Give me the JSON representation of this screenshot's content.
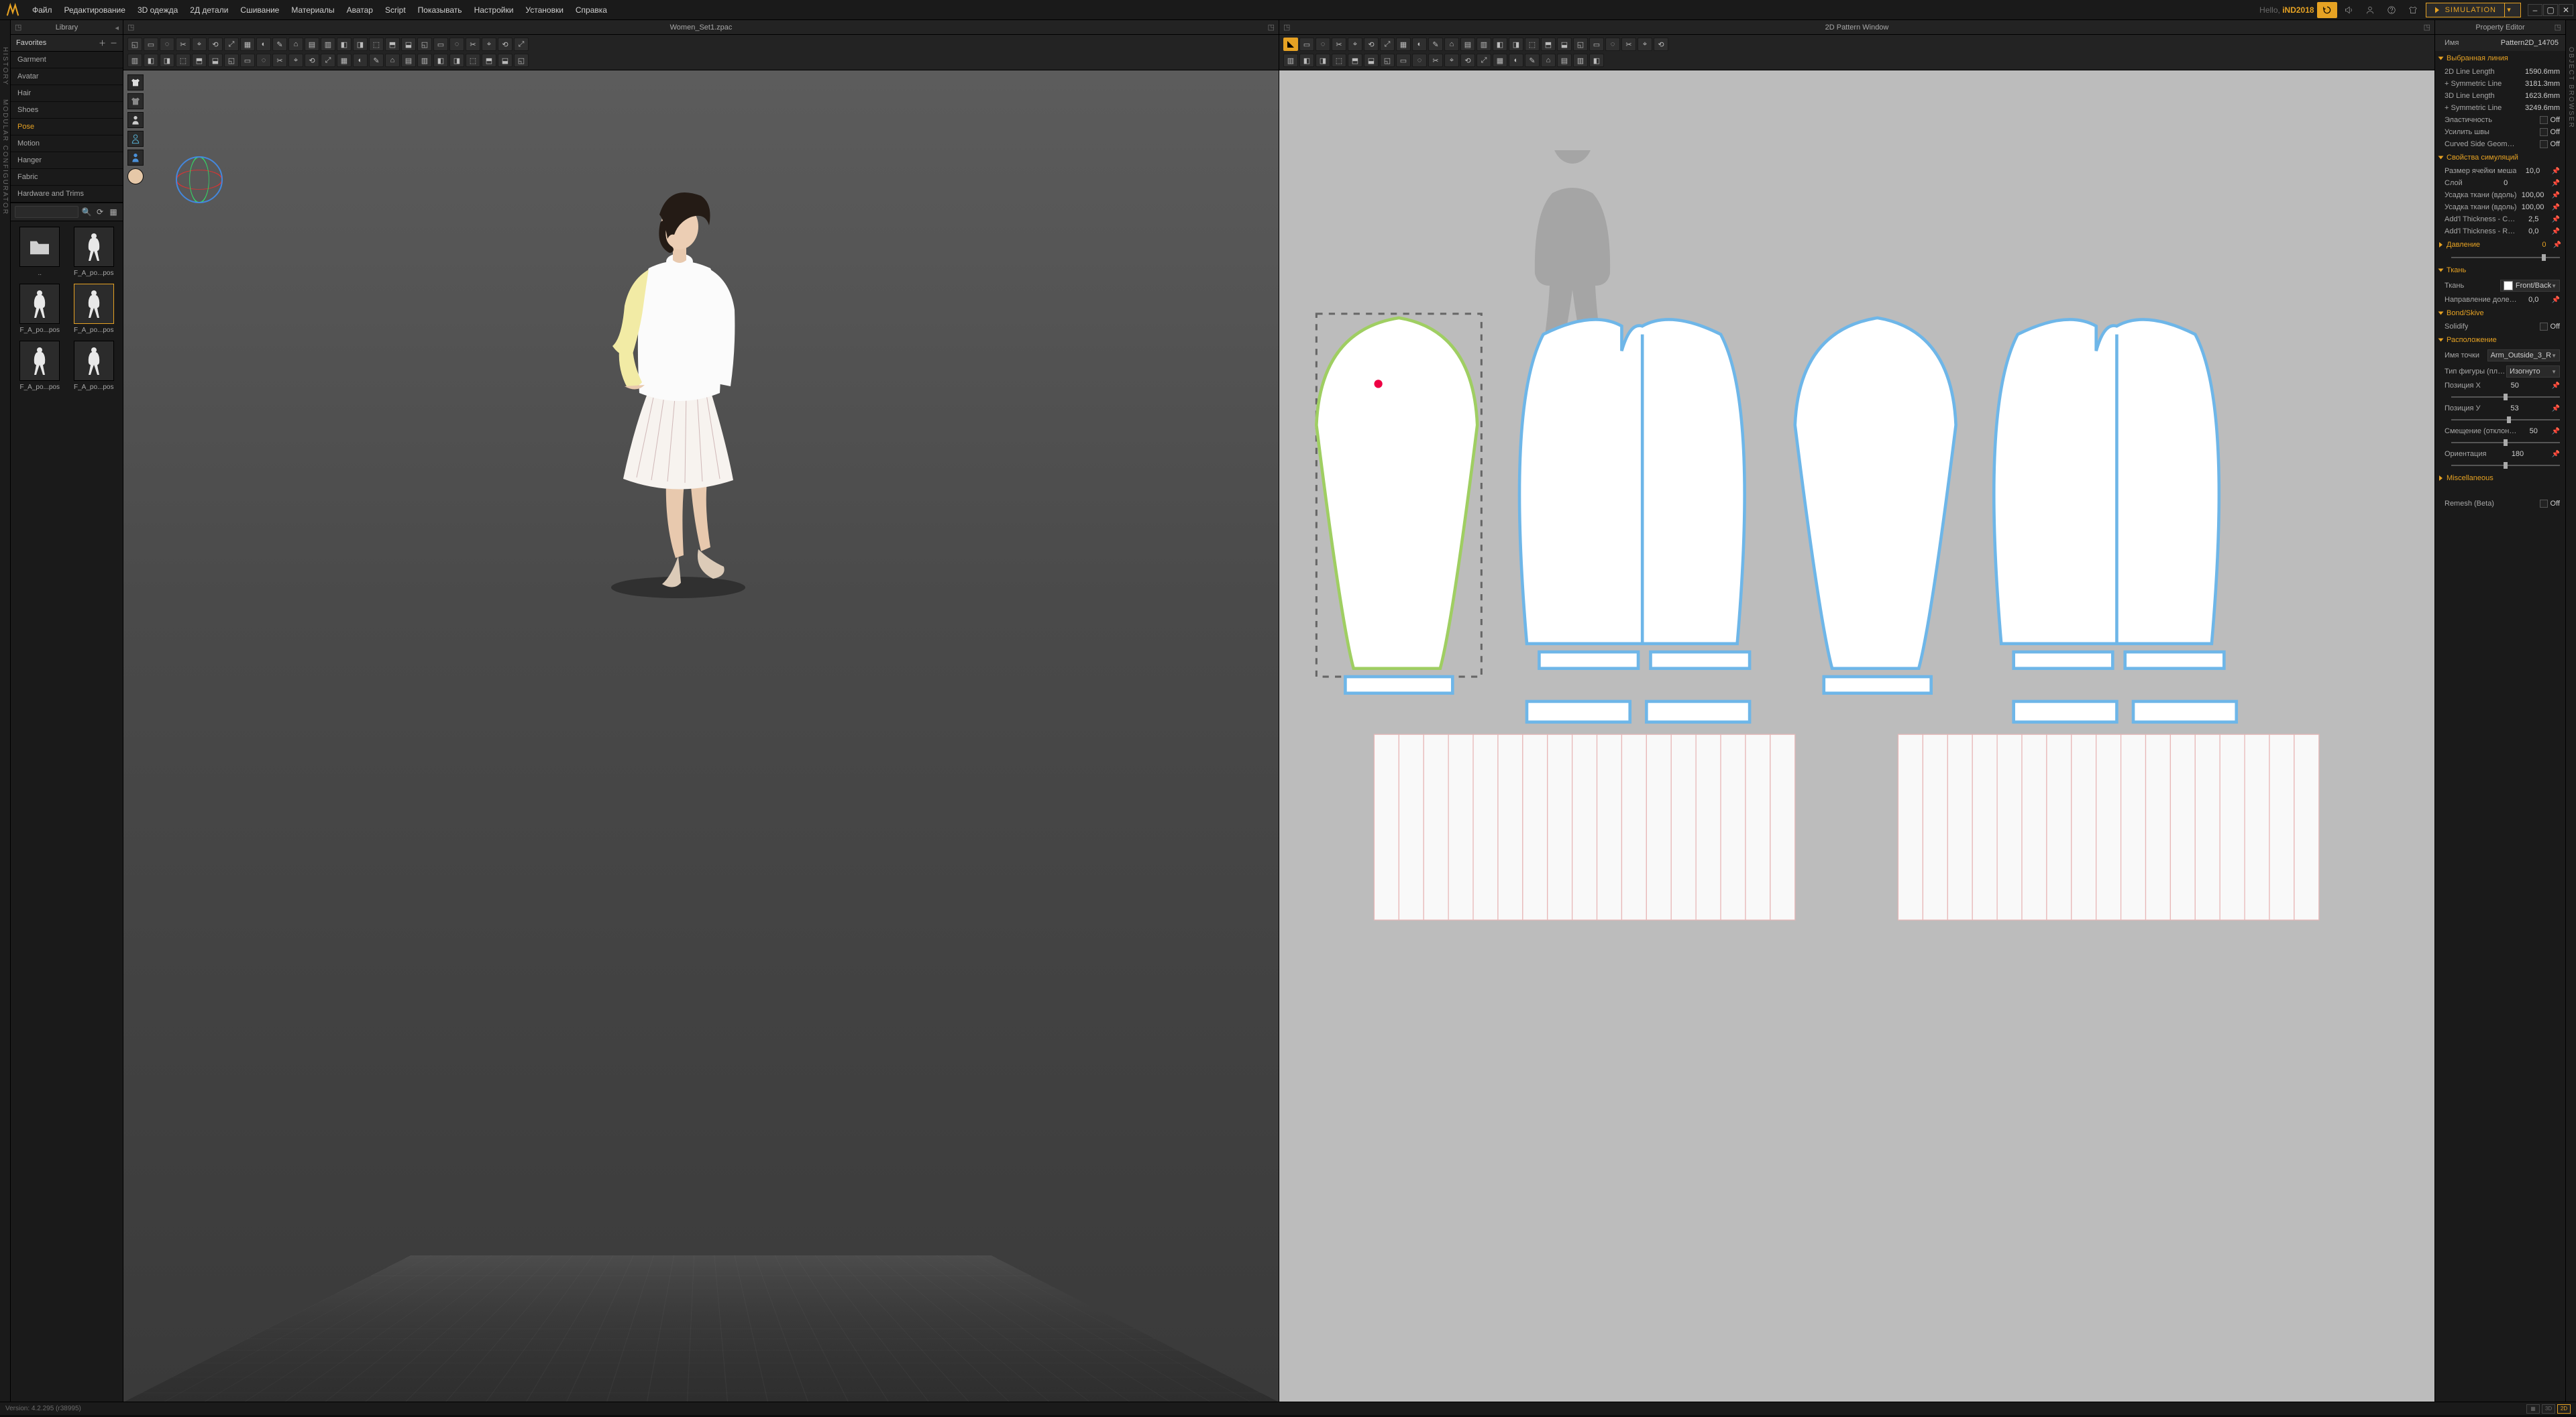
{
  "menubar": [
    "Файл",
    "Редактирование",
    "3D одежда",
    "2Д детали",
    "Сшивание",
    "Материалы",
    "Аватар",
    "Script",
    "Показывать",
    "Настройки",
    "Установки",
    "Справка"
  ],
  "hello_prefix": "Hello,",
  "username": "iND2018",
  "sim_button": "SIMULATION",
  "left_rail": [
    "HISTORY",
    "MODULAR CONFIGURATOR"
  ],
  "right_rail": [
    "OBJECT BROWSER"
  ],
  "library": {
    "title": "Library",
    "favorites_label": "Favorites",
    "categories": [
      "Garment",
      "Avatar",
      "Hair",
      "Shoes",
      "Pose",
      "Motion",
      "Hanger",
      "Fabric",
      "Hardware and Trims"
    ],
    "selected_category": "Pose",
    "thumbs": [
      {
        "label": "..",
        "type": "folder"
      },
      {
        "label": "F_A_po...pos",
        "type": "avatar"
      },
      {
        "label": "F_A_po...pos",
        "type": "avatar"
      },
      {
        "label": "F_A_po...pos",
        "type": "avatar",
        "selected": true
      },
      {
        "label": "F_A_po...pos",
        "type": "avatar"
      },
      {
        "label": "F_A_po...pos",
        "type": "avatar"
      }
    ]
  },
  "view3d": {
    "title": "Women_Set1.zpac",
    "tool_count_row1": 25,
    "tool_count_row2": 25
  },
  "view2d": {
    "title": "2D Pattern Window",
    "tool_count_row1": 24,
    "tool_count_row2": 20
  },
  "property_editor": {
    "title": "Property Editor",
    "name_label": "Имя",
    "name_value": "Pattern2D_14705",
    "sections": {
      "selected_line": {
        "title": "Выбранная линия",
        "rows": [
          {
            "k": "2D Line Length",
            "v": "1590.6mm"
          },
          {
            "k": "+ Symmetric Line",
            "v": "3181.3mm"
          },
          {
            "k": "3D Line Length",
            "v": "1623.6mm"
          },
          {
            "k": "+ Symmetric Line",
            "v": "3249.6mm"
          },
          {
            "k": "Эластичность",
            "v": "Off",
            "check": true
          },
          {
            "k": "Усилить швы",
            "v": "Off",
            "check": true
          },
          {
            "k": "Curved Side Geometry",
            "v": "Off",
            "check": true
          }
        ]
      },
      "simulation": {
        "title": "Свойства симуляций",
        "rows": [
          {
            "k": "Размер ячейки меша",
            "v": "10,0",
            "pin": true
          },
          {
            "k": "Слой",
            "v": "0",
            "pin": true
          },
          {
            "k": "Усадка ткани (вдоль)",
            "v": "100,00",
            "pin": true
          },
          {
            "k": "Усадка ткани (вдоль)",
            "v": "100,00",
            "pin": true
          },
          {
            "k": "Add'l Thickness - Collision",
            "v": "2,5",
            "pin": true
          },
          {
            "k": "Add'l Thickness - Render",
            "v": "0,0",
            "pin": true
          }
        ]
      },
      "pressure": {
        "title": "Давление",
        "value": "0",
        "slider": 85
      },
      "fabric": {
        "title": "Ткань",
        "rows": [
          {
            "k": "Ткань",
            "dd": "Front/Back",
            "swatch": true
          },
          {
            "k": "Направление долевой",
            "v": "0,0",
            "pin": true
          }
        ]
      },
      "bond": {
        "title": "Bond/Skive",
        "rows": [
          {
            "k": "Solidify",
            "v": "Off",
            "check": true
          }
        ]
      },
      "arrangement": {
        "title": "Расположение",
        "rows": [
          {
            "k": "Имя точки",
            "dd": "Arm_Outside_3_R"
          },
          {
            "k": "Тип фигуры (плоский)",
            "dd": "Изогнуто"
          }
        ],
        "sliders": [
          {
            "k": "Позиция X",
            "v": "50",
            "pos": 50
          },
          {
            "k": "Позиция У",
            "v": "53",
            "pos": 53
          },
          {
            "k": "Смещение (отклонение)",
            "v": "50",
            "pos": 50
          },
          {
            "k": "Ориентация",
            "v": "180",
            "pos": 50
          }
        ]
      },
      "misc": {
        "title": "Miscellaneous"
      },
      "remesh": {
        "k": "Remesh (Beta)",
        "v": "Off"
      }
    }
  },
  "status": {
    "version": "Version: 4.2.295 (r38995)",
    "modes": [
      "3D",
      "2D"
    ]
  }
}
